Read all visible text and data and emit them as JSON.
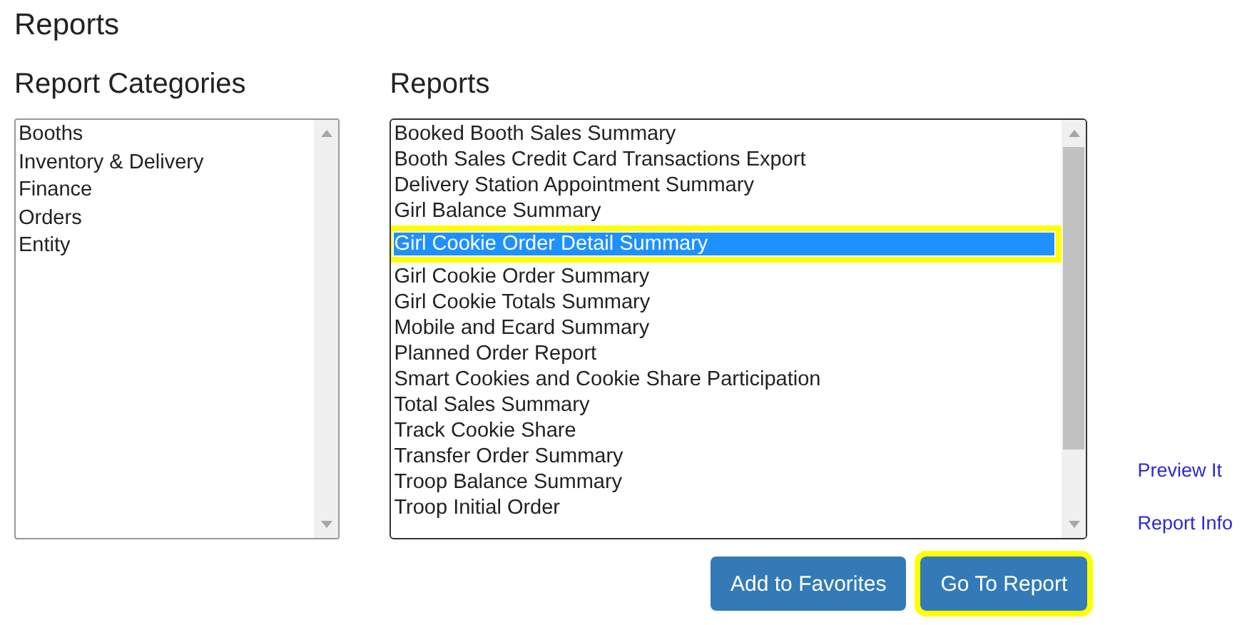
{
  "page_title": "Reports",
  "categories": {
    "heading": "Report Categories",
    "items": [
      {
        "label": "Booths",
        "selected": false
      },
      {
        "label": "Inventory & Delivery",
        "selected": false
      },
      {
        "label": "Finance",
        "selected": false
      },
      {
        "label": "Orders",
        "selected": false
      },
      {
        "label": "Entity",
        "selected": false
      }
    ]
  },
  "reports": {
    "heading": "Reports",
    "items": [
      {
        "label": "Booked Booth Sales Summary",
        "selected": false,
        "highlighted": false
      },
      {
        "label": "Booth Sales Credit Card Transactions Export",
        "selected": false,
        "highlighted": false
      },
      {
        "label": "Delivery Station Appointment Summary",
        "selected": false,
        "highlighted": false
      },
      {
        "label": "Girl Balance Summary",
        "selected": false,
        "highlighted": false
      },
      {
        "label": "Girl Cookie Order Detail Summary",
        "selected": true,
        "highlighted": true
      },
      {
        "label": "Girl Cookie Order Summary",
        "selected": false,
        "highlighted": false
      },
      {
        "label": "Girl Cookie Totals Summary",
        "selected": false,
        "highlighted": false
      },
      {
        "label": "Mobile and Ecard Summary",
        "selected": false,
        "highlighted": false
      },
      {
        "label": "Planned Order Report",
        "selected": false,
        "highlighted": false
      },
      {
        "label": "Smart Cookies and Cookie Share Participation",
        "selected": false,
        "highlighted": false
      },
      {
        "label": "Total Sales Summary",
        "selected": false,
        "highlighted": false
      },
      {
        "label": "Track Cookie Share",
        "selected": false,
        "highlighted": false
      },
      {
        "label": "Transfer Order Summary",
        "selected": false,
        "highlighted": false
      },
      {
        "label": "Troop Balance Summary",
        "selected": false,
        "highlighted": false
      },
      {
        "label": "Troop Initial Order",
        "selected": false,
        "highlighted": false
      }
    ]
  },
  "links": [
    "Preview It",
    "Report Info"
  ],
  "buttons": [
    {
      "label": "Add to Favorites",
      "highlighted": false
    },
    {
      "label": "Go To Report",
      "highlighted": true
    }
  ]
}
